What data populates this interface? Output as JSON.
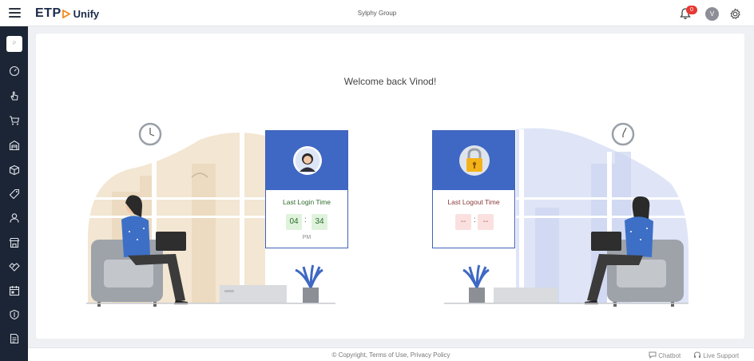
{
  "header": {
    "brand_main": "ETP",
    "brand_sub": "Unify",
    "company": "Sylphy Group",
    "notification_count": "0",
    "user_initial": "V"
  },
  "sidebar": {
    "logo_text": "P",
    "items": [
      "dashboard-icon",
      "hand-pointer-icon",
      "cart-icon",
      "warehouse-icon",
      "box-icon",
      "tag-icon",
      "person-icon",
      "store-icon",
      "handshake-icon",
      "calendar-icon",
      "shield-icon",
      "report-icon"
    ]
  },
  "main": {
    "welcome": "Welcome back Vinod!",
    "login": {
      "title": "Last Login Time",
      "hour": "04",
      "minute": "34",
      "ampm": "PM"
    },
    "logout": {
      "title": "Last Logout Time",
      "hour": "--",
      "minute": "--"
    }
  },
  "footer": {
    "copyright": "© Copyright,",
    "terms": "Terms of Use,",
    "privacy": "Privacy Policy",
    "chatbot": "Chatbot",
    "support": "Live Support"
  },
  "colors": {
    "sidebar": "#1c2535",
    "accent_blue": "#3f68c4",
    "login_green": "#2e6b2c",
    "logout_red": "#c06060"
  }
}
